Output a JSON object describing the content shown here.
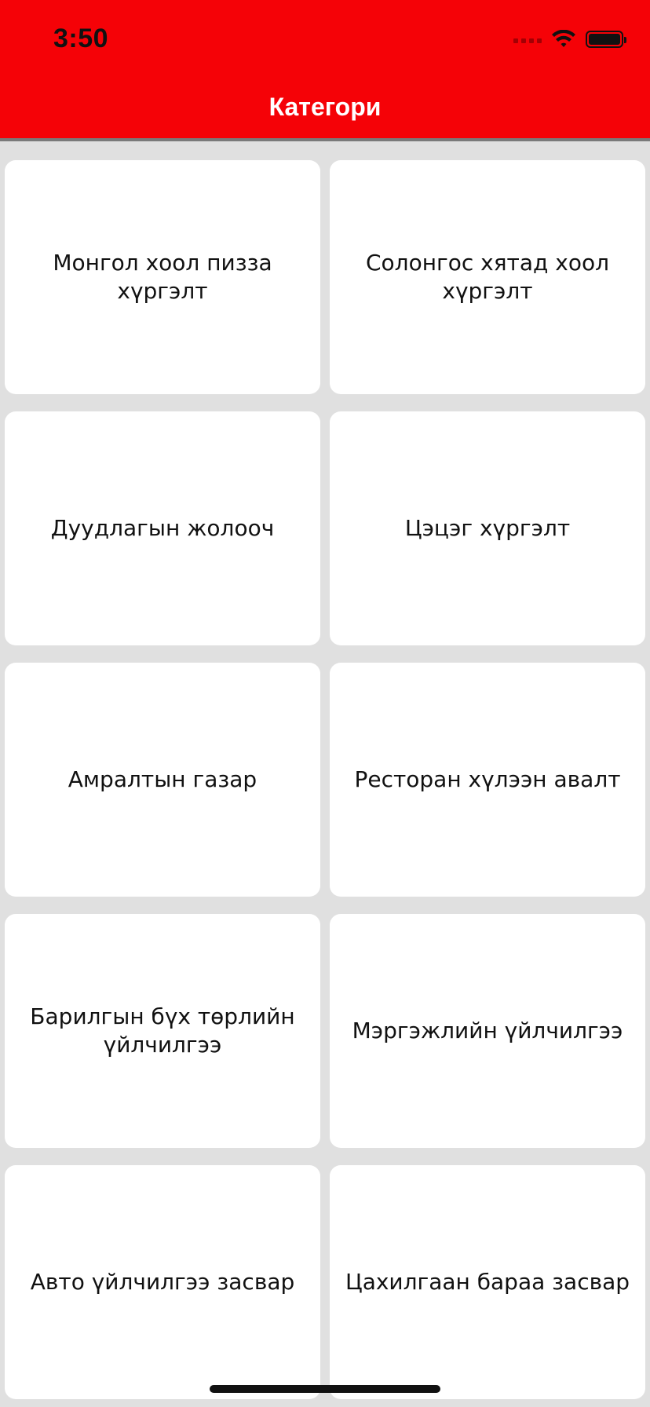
{
  "status_bar": {
    "time": "3:50"
  },
  "header": {
    "title": "Категори",
    "background_color": "#f50207"
  },
  "categories": [
    {
      "label": "Монгол хоол пизза хүргэлт"
    },
    {
      "label": "Солонгос хятад хоол хүргэлт"
    },
    {
      "label": "Дуудлагын жолооч"
    },
    {
      "label": "Цэцэг хүргэлт"
    },
    {
      "label": "Амралтын газар"
    },
    {
      "label": "Ресторан хүлээн авалт"
    },
    {
      "label": "Барилгын бүх төрлийн үйлчилгээ"
    },
    {
      "label": "Мэргэжлийн үйлчилгээ"
    },
    {
      "label": "Авто үйлчилгээ засвар"
    },
    {
      "label": "Цахилгаан бараа засвар"
    }
  ],
  "icons": [
    "signal-icon",
    "wifi-icon",
    "battery-icon"
  ]
}
